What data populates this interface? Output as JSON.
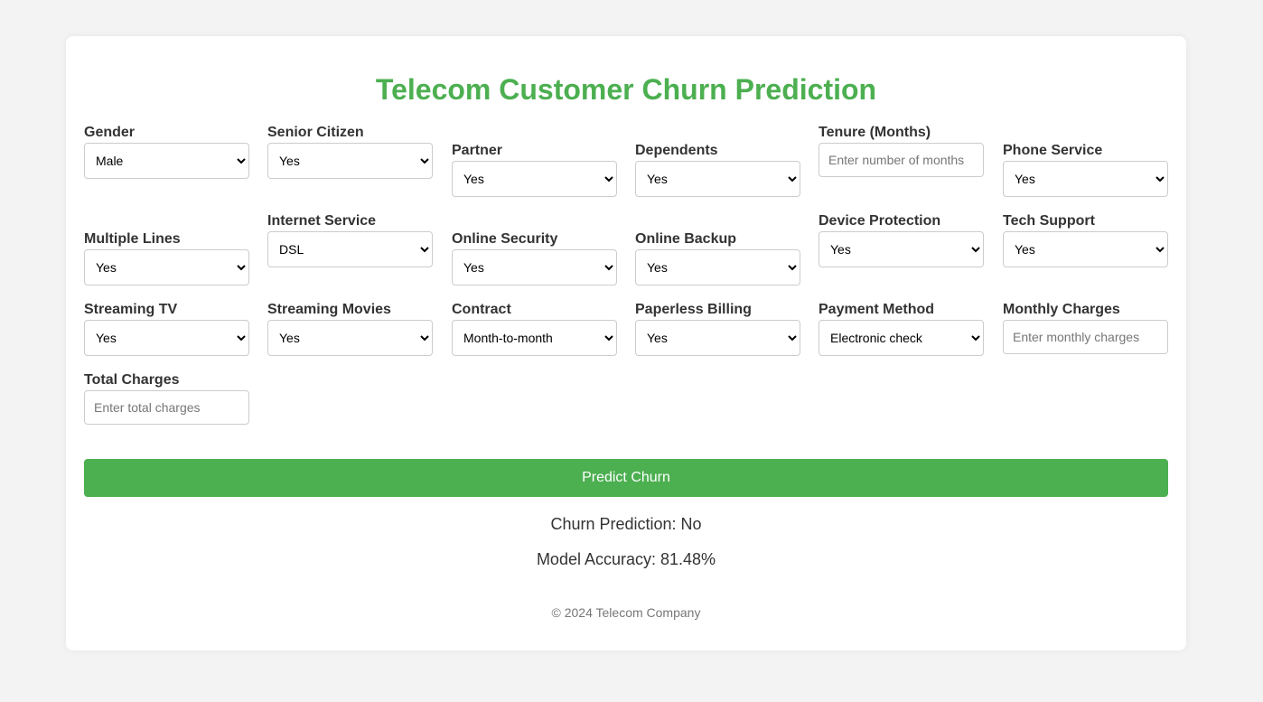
{
  "title": "Telecom Customer Churn Prediction",
  "fields": {
    "gender": {
      "label": "Gender",
      "value": "Male"
    },
    "senior_citizen": {
      "label": "Senior Citizen",
      "value": "Yes"
    },
    "partner": {
      "label": "Partner",
      "value": "Yes"
    },
    "dependents": {
      "label": "Dependents",
      "value": "Yes"
    },
    "tenure": {
      "label": "Tenure (Months)",
      "placeholder": "Enter number of months"
    },
    "phone_service": {
      "label": "Phone Service",
      "value": "Yes"
    },
    "multiple_lines": {
      "label": "Multiple Lines",
      "value": "Yes"
    },
    "internet_service": {
      "label": "Internet Service",
      "value": "DSL"
    },
    "online_security": {
      "label": "Online Security",
      "value": "Yes"
    },
    "online_backup": {
      "label": "Online Backup",
      "value": "Yes"
    },
    "device_protection": {
      "label": "Device Protection",
      "value": "Yes"
    },
    "tech_support": {
      "label": "Tech Support",
      "value": "Yes"
    },
    "streaming_tv": {
      "label": "Streaming TV",
      "value": "Yes"
    },
    "streaming_movies": {
      "label": "Streaming Movies",
      "value": "Yes"
    },
    "contract": {
      "label": "Contract",
      "value": "Month-to-month"
    },
    "paperless_billing": {
      "label": "Paperless Billing",
      "value": "Yes"
    },
    "payment_method": {
      "label": "Payment Method",
      "value": "Electronic check"
    },
    "monthly_charges": {
      "label": "Monthly Charges",
      "placeholder": "Enter monthly charges"
    },
    "total_charges": {
      "label": "Total Charges",
      "placeholder": "Enter total charges"
    }
  },
  "predict_button": "Predict Churn",
  "prediction_text": "Churn Prediction: No",
  "accuracy_text": "Model Accuracy: 81.48%",
  "footer": "© 2024 Telecom Company",
  "colors": {
    "accent": "#4caf50",
    "background": "#f3f3f3",
    "card": "#ffffff"
  }
}
